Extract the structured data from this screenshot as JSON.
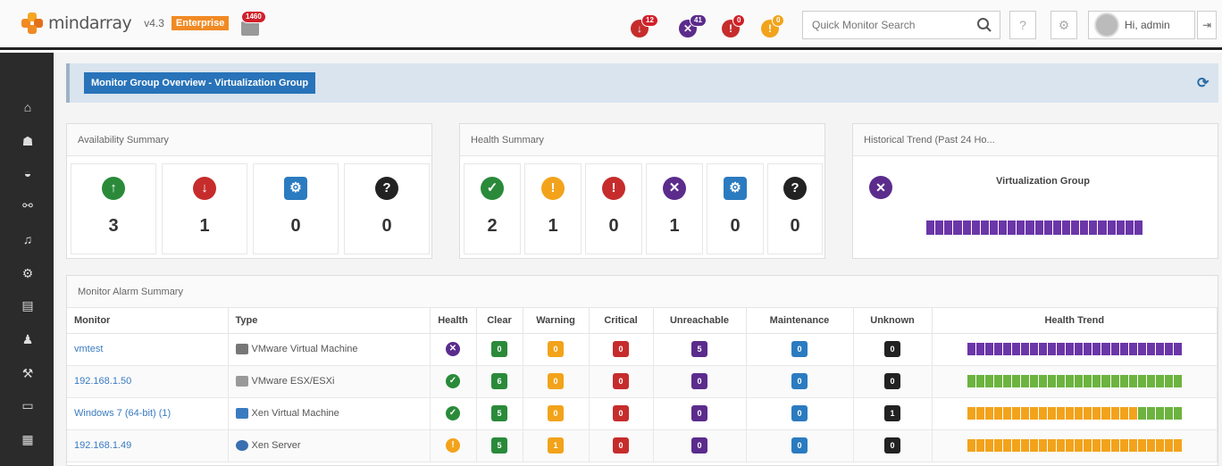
{
  "brand": {
    "name": "mindarray",
    "version": "v4.3",
    "edition": "Enterprise"
  },
  "topbar": {
    "alert_count": "1460",
    "status_counts": [
      {
        "name": "down",
        "count": "12",
        "color": "#c62c2c"
      },
      {
        "name": "unreachable",
        "count": "41",
        "color": "#5b2c8c"
      },
      {
        "name": "critical",
        "count": "0",
        "color": "#c62c2c"
      },
      {
        "name": "warning",
        "count": "0",
        "color": "#f2a31b"
      }
    ],
    "search_placeholder": "Quick Monitor Search",
    "help_label": "?",
    "user_label": "Hi, admin"
  },
  "page": {
    "title": "Monitor Group Overview - Virtualization Group"
  },
  "availability": {
    "title": "Availability Summary",
    "items": [
      {
        "name": "up",
        "count": "3",
        "color": "#2a8a3a"
      },
      {
        "name": "down",
        "count": "1",
        "color": "#c62c2c"
      },
      {
        "name": "maintenance",
        "count": "0",
        "color": "#2b7bc0"
      },
      {
        "name": "unknown",
        "count": "0",
        "color": "#222222"
      }
    ]
  },
  "health": {
    "title": "Health Summary",
    "items": [
      {
        "name": "clear",
        "count": "2",
        "color": "#2a8a3a"
      },
      {
        "name": "warning",
        "count": "1",
        "color": "#f2a31b"
      },
      {
        "name": "critical",
        "count": "0",
        "color": "#c62c2c"
      },
      {
        "name": "unreachable",
        "count": "1",
        "color": "#5b2c8c"
      },
      {
        "name": "maintenance",
        "count": "0",
        "color": "#2b7bc0"
      },
      {
        "name": "unknown",
        "count": "0",
        "color": "#222222"
      }
    ]
  },
  "trend": {
    "title": "Historical Trend (Past 24 Ho...",
    "group_label": "Virtualization Group",
    "bar_color": "#6b36a8"
  },
  "alarm_summary": {
    "title": "Monitor Alarm Summary",
    "columns": [
      "Monitor",
      "Type",
      "Health",
      "Clear",
      "Warning",
      "Critical",
      "Unreachable",
      "Maintenance",
      "Unknown",
      "Health Trend"
    ],
    "rows": [
      {
        "monitor": "vmtest",
        "type": "VMware Virtual Machine",
        "health": "unreachable",
        "clear": "0",
        "warning": "0",
        "critical": "0",
        "unreachable": "5",
        "maintenance": "0",
        "unknown": "0",
        "trend": [
          [
            "#6b36a8",
            1.0
          ]
        ]
      },
      {
        "monitor": "192.168.1.50",
        "type": "VMware ESX/ESXi",
        "health": "clear",
        "clear": "6",
        "warning": "0",
        "critical": "0",
        "unreachable": "0",
        "maintenance": "0",
        "unknown": "0",
        "trend": [
          [
            "#6cb33f",
            1.0
          ]
        ]
      },
      {
        "monitor": "Windows 7 (64-bit) (1)",
        "type": "Xen Virtual Machine",
        "health": "clear",
        "clear": "5",
        "warning": "0",
        "critical": "0",
        "unreachable": "0",
        "maintenance": "0",
        "unknown": "1",
        "trend": [
          [
            "#f2a31b",
            0.8
          ],
          [
            "#6cb33f",
            0.2
          ]
        ]
      },
      {
        "monitor": "192.168.1.49",
        "type": "Xen Server",
        "health": "warning",
        "clear": "5",
        "warning": "1",
        "critical": "0",
        "unreachable": "0",
        "maintenance": "0",
        "unknown": "0",
        "trend": [
          [
            "#f2a31b",
            1.0
          ]
        ]
      }
    ]
  },
  "colors": {
    "clear": "#2a8a3a",
    "warning": "#f2a31b",
    "critical": "#c62c2c",
    "unreachable": "#5b2c8c",
    "maintenance": "#2b7bc0",
    "unknown": "#222222"
  }
}
